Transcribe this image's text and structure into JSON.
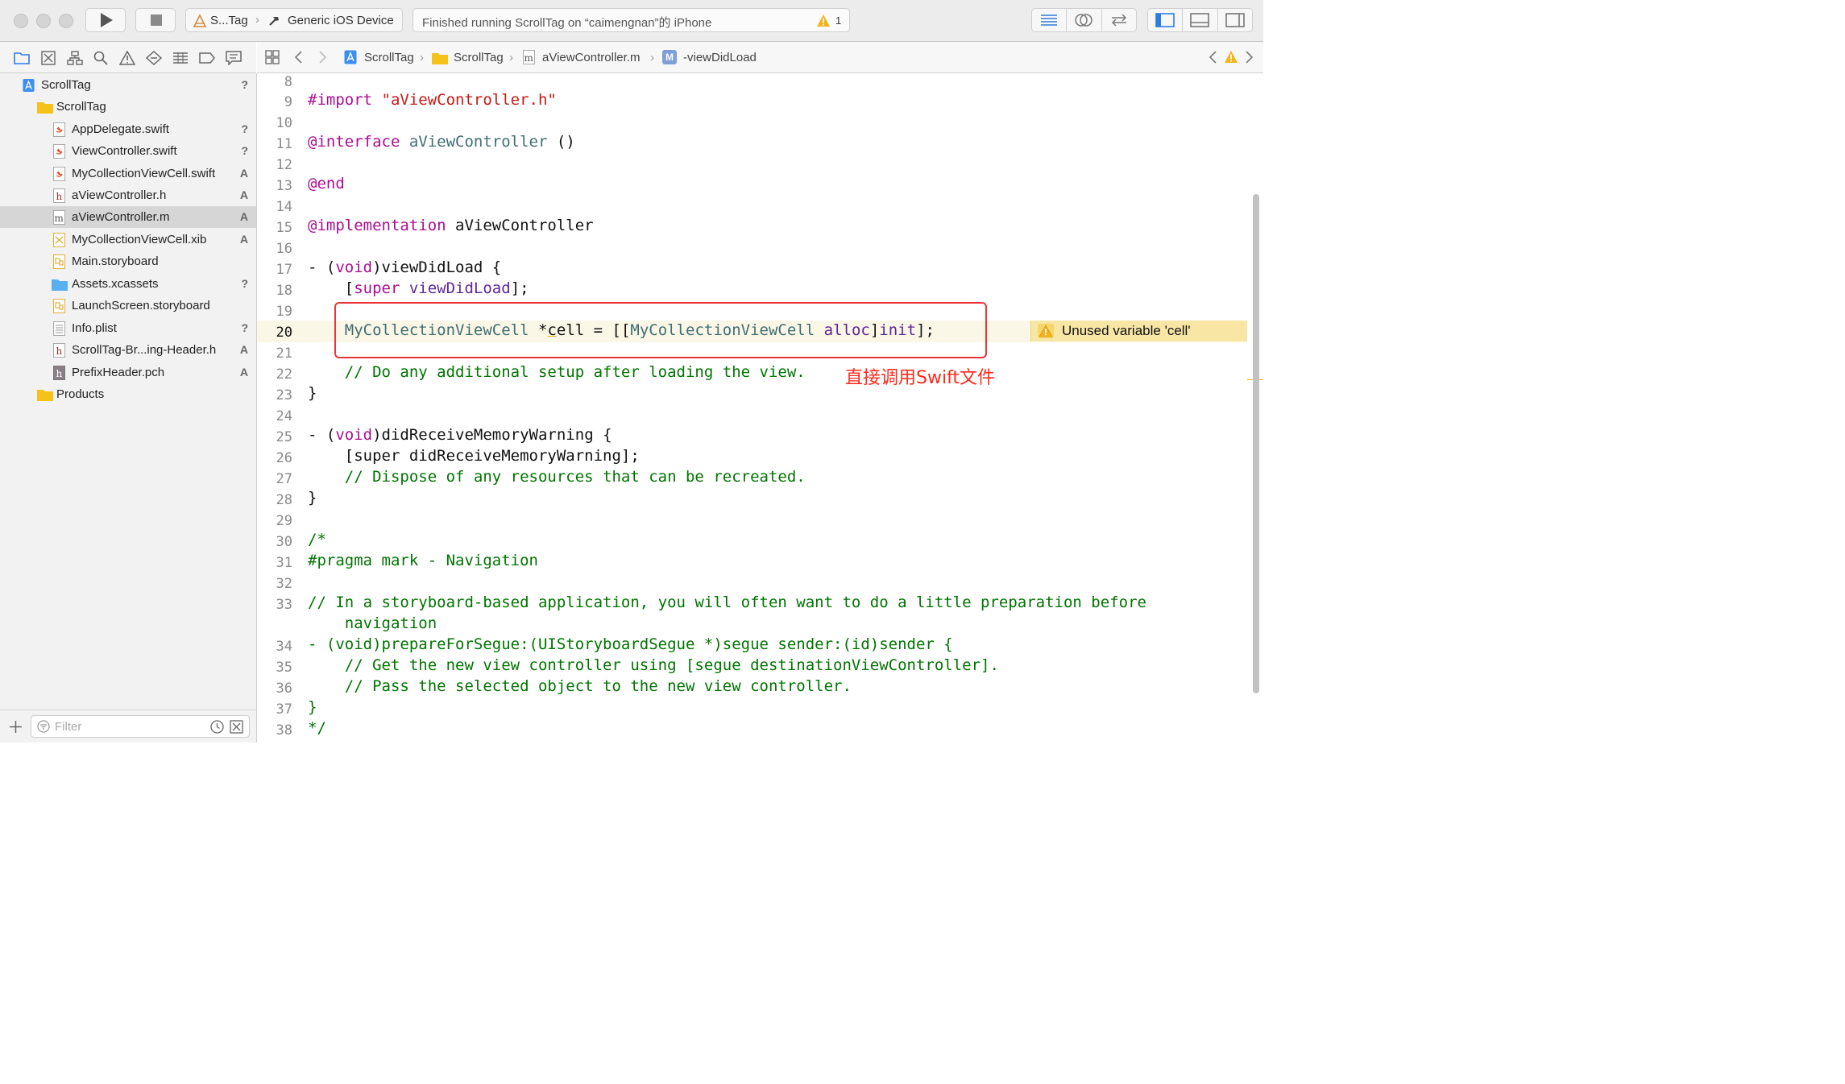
{
  "toolbar": {
    "scheme_target": "S...Tag",
    "device": "Generic iOS Device",
    "status": "Finished running ScrollTag on “caimengnan”的 iPhone",
    "warning_count": "1"
  },
  "sidebar": {
    "items": [
      {
        "label": "ScrollTag",
        "status": "?"
      },
      {
        "label": "ScrollTag",
        "status": ""
      },
      {
        "label": "AppDelegate.swift",
        "status": "?"
      },
      {
        "label": "ViewController.swift",
        "status": "?"
      },
      {
        "label": "MyCollectionViewCell.swift",
        "status": "A"
      },
      {
        "label": "aViewController.h",
        "status": "A"
      },
      {
        "label": "aViewController.m",
        "status": "A"
      },
      {
        "label": "MyCollectionViewCell.xib",
        "status": "A"
      },
      {
        "label": "Main.storyboard",
        "status": ""
      },
      {
        "label": "Assets.xcassets",
        "status": "?"
      },
      {
        "label": "LaunchScreen.storyboard",
        "status": ""
      },
      {
        "label": "Info.plist",
        "status": "?"
      },
      {
        "label": "ScrollTag-Br...ing-Header.h",
        "status": "A"
      },
      {
        "label": "PrefixHeader.pch",
        "status": "A"
      },
      {
        "label": "Products",
        "status": ""
      }
    ],
    "filter_placeholder": "Filter"
  },
  "jumpbar": {
    "crumbs": [
      "ScrollTag",
      "ScrollTag",
      "aViewController.m",
      "-viewDidLoad"
    ],
    "method_badge": "M"
  },
  "editor": {
    "line_numbers": [
      "8",
      "9",
      "10",
      "11",
      "12",
      "13",
      "14",
      "15",
      "16",
      "17",
      "18",
      "19",
      "20",
      "21",
      "22",
      "23",
      "24",
      "25",
      "26",
      "27",
      "28",
      "29",
      "30",
      "31",
      "32",
      "33",
      "",
      "34",
      "35",
      "36",
      "37",
      "38"
    ],
    "issue_text": "Unused variable 'cell'",
    "annotation": "直接调用Swift文件"
  }
}
